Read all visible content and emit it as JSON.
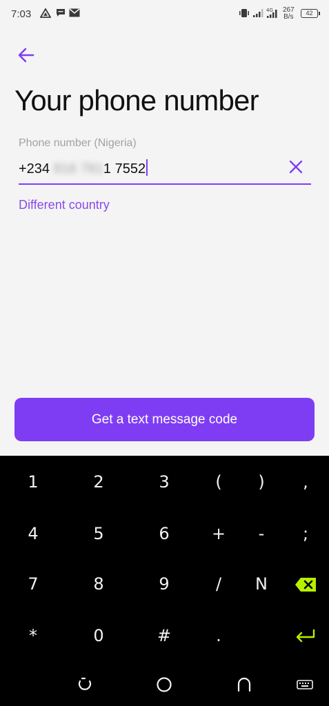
{
  "status_bar": {
    "time": "7:03",
    "network_type": "4G",
    "speed_value": "267",
    "speed_unit": "B/s",
    "battery": "42"
  },
  "header": {
    "back_icon": "arrow-left-icon",
    "title": "Your phone number"
  },
  "phone_input": {
    "label": "Phone number (Nigeria)",
    "prefix": "+234 ",
    "masked_part": "816 781",
    "suffix": "1 7552",
    "clear_icon": "close-icon"
  },
  "different_country_link": "Different country",
  "submit_button": "Get a text message code",
  "keyboard": {
    "rows": [
      [
        "1",
        "2",
        "3",
        "(",
        ")",
        ","
      ],
      [
        "4",
        "5",
        "6",
        "+",
        "-",
        ";"
      ],
      [
        "7",
        "8",
        "9",
        "/",
        "N",
        "backspace"
      ],
      [
        "*",
        "0",
        "#",
        ".",
        "",
        "enter"
      ]
    ]
  },
  "nav_bar": [
    "recents-icon",
    "home-icon",
    "back-nav-icon",
    "keyboard-icon"
  ],
  "colors": {
    "accent": "#7f3df3",
    "link": "#8a4ae8",
    "keyboard_bg": "#000000",
    "keyboard_accent": "#b6f000"
  }
}
